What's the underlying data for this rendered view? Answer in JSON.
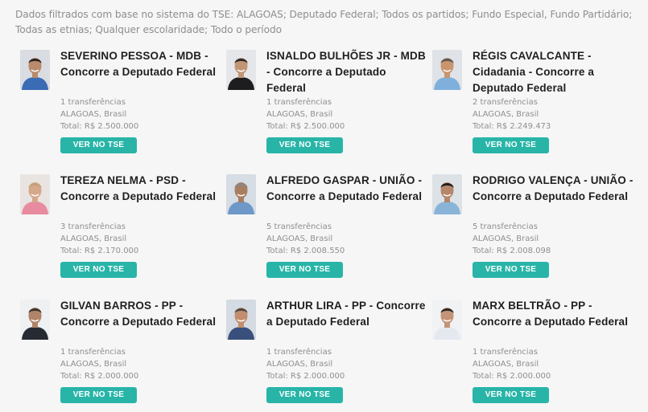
{
  "filter": "Dados filtrados com base no sistema do TSE: ALAGOAS; Deputado Federal; Todos os partidos; Fundo Especial, Fundo Partidário; Todas as etnias; Qualquer escolaridade; Todo o período",
  "button_label": "VER NO TSE",
  "candidates": [
    {
      "name": "SEVERINO PESSOA - MDB - Concorre a Deputado Federal",
      "transfers": "1 transferências",
      "location": "ALAGOAS, Brasil",
      "total": "Total: R$ 2.500.000",
      "photo": {
        "bg": "#d9dde2",
        "skin": "#b98a6c",
        "hair": "#2a2522",
        "shirt": "#3a6bb5"
      }
    },
    {
      "name": "ISNALDO BULHÕES JR - MDB - Concorre a Deputado Federal",
      "transfers": "1 transferências",
      "location": "ALAGOAS, Brasil",
      "total": "Total: R$ 2.500.000",
      "photo": {
        "bg": "#e4e6ea",
        "skin": "#c39577",
        "hair": "#2b2724",
        "shirt": "#1d1d1f"
      }
    },
    {
      "name": "RÉGIS CAVALCANTE - Cidadania - Concorre a Deputado Federal",
      "transfers": "2 transferências",
      "location": "ALAGOAS, Brasil",
      "total": "Total: R$ 2.249.473",
      "photo": {
        "bg": "#dfe3e8",
        "skin": "#c9946e",
        "hair": "#5d5650",
        "shirt": "#7fb0dc"
      }
    },
    {
      "name": "TEREZA NELMA - PSD - Concorre a Deputado Federal",
      "transfers": "3 transferências",
      "location": "ALAGOAS, Brasil",
      "total": "Total: R$ 2.170.000",
      "photo": {
        "bg": "#e9e4e1",
        "skin": "#d6a88a",
        "hair": "#c3a27a",
        "shirt": "#e88aa0"
      }
    },
    {
      "name": "ALFREDO GASPAR - UNIÃO - Concorre a Deputado Federal",
      "transfers": "5 transferências",
      "location": "ALAGOAS, Brasil",
      "total": "Total: R$ 2.008.550",
      "photo": {
        "bg": "#d7dde4",
        "skin": "#a87e63",
        "hair": "#8a8682",
        "shirt": "#6e98c8"
      }
    },
    {
      "name": "RODRIGO VALENÇA - UNIÃO - Concorre a Deputado Federal",
      "transfers": "5 transferências",
      "location": "ALAGOAS, Brasil",
      "total": "Total: R$ 2.008.098",
      "photo": {
        "bg": "#dde2e7",
        "skin": "#b5866a",
        "hair": "#231f1c",
        "shirt": "#89b4d8"
      }
    },
    {
      "name": "GILVAN BARROS - PP - Concorre a Deputado Federal",
      "transfers": "1 transferências",
      "location": "ALAGOAS, Brasil",
      "total": "Total: R$ 2.000.000",
      "photo": {
        "bg": "#eef0f2",
        "skin": "#b08468",
        "hair": "#3b3430",
        "shirt": "#262a33"
      }
    },
    {
      "name": "ARTHUR LIRA - PP - Concorre a Deputado Federal",
      "transfers": "1 transferências",
      "location": "ALAGOAS, Brasil",
      "total": "Total: R$ 2.000.000",
      "photo": {
        "bg": "#d5dbe2",
        "skin": "#c28e6e",
        "hair": "#4f4842",
        "shirt": "#39507c"
      }
    },
    {
      "name": "MARX BELTRÃO - PP - Concorre a Deputado Federal",
      "transfers": "1 transferências",
      "location": "ALAGOAS, Brasil",
      "total": "Total: R$ 2.000.000",
      "photo": {
        "bg": "#f1f2f4",
        "skin": "#c39478",
        "hair": "#2d2825",
        "shirt": "#e4e9f0"
      }
    }
  ]
}
